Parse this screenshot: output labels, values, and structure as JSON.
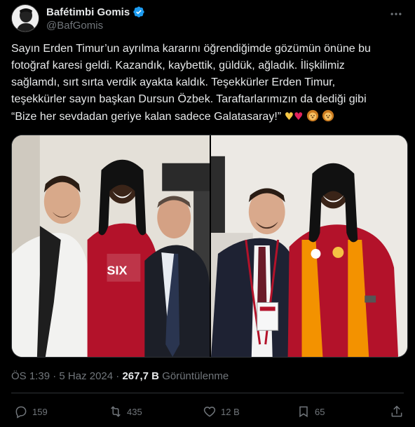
{
  "author": {
    "name": "Bafétimbi Gomis",
    "handle": "@BafGomis",
    "verified": true
  },
  "tweet": {
    "lines": [
      "Sayın Erden Timur’un ayrılma kararını öğrendiğimde gözümün önüne bu",
      "fotoğraf karesi geldi. Kazandık, kaybettik, güldük, ağladık. İlişkilimiz",
      "sağlamdı, sırt sırta verdik ayakta kaldık. Teşekkürler Erden Timur,",
      "teşekkürler sayın başkan Dursun Özbek. Taraftarlarımızın da dediği gibi",
      "“Bize her sevdadan geriye kalan sadece Galatasaray!”"
    ],
    "emojis": [
      "yellow-heart",
      "red-heart",
      "lion-face",
      "lion-face"
    ]
  },
  "meta": {
    "time": "ÖS 1:39",
    "separator": "·",
    "date": "5 Haz 2024",
    "separator2": "·",
    "views_count": "267,7 B",
    "views_label": "Görüntülenme"
  },
  "actions": {
    "replies": "159",
    "retweets": "435",
    "likes": "12 B",
    "bookmarks": "65"
  },
  "colors": {
    "background": "#000000",
    "text": "#e7e9ea",
    "secondary": "#71767b",
    "verified": "#1d9bf0",
    "border": "#2f3336",
    "galatasaray_red": "#a6192e",
    "galatasaray_orange": "#f39200"
  }
}
